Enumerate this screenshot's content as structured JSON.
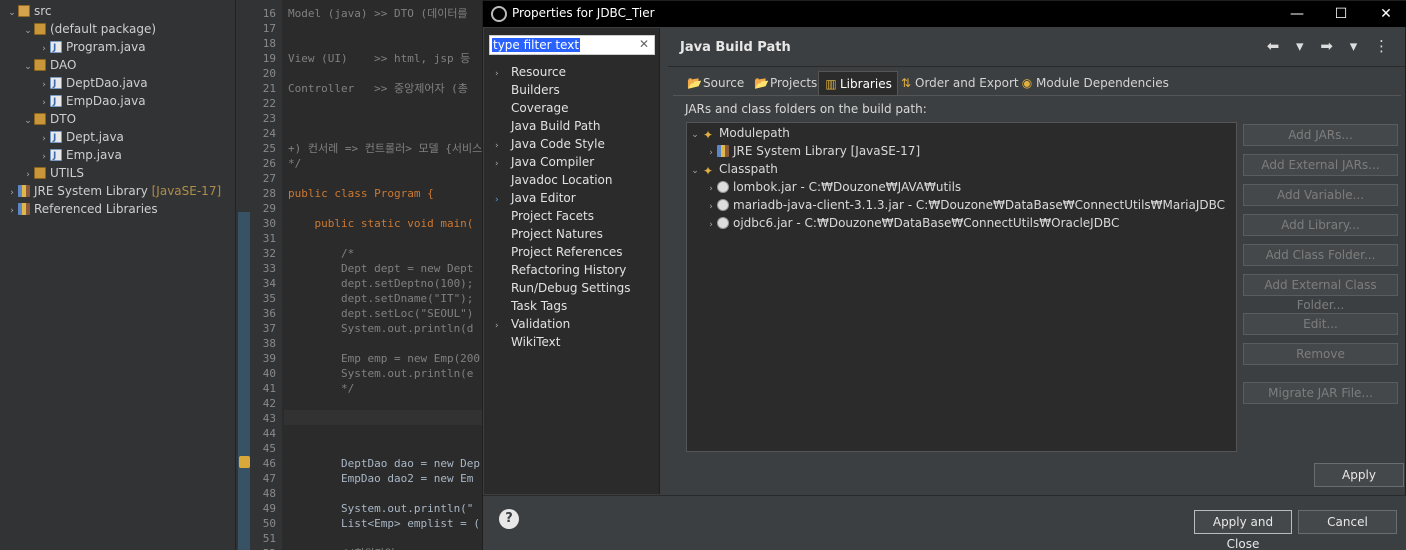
{
  "explorer": {
    "items": [
      {
        "label": "src",
        "icon": "folder-icon",
        "twisty": "⌄"
      },
      {
        "label": "(default package)",
        "icon": "package-icon",
        "twisty": "⌄"
      },
      {
        "label": "Program.java",
        "icon": "java-file-icon",
        "twisty": "›"
      },
      {
        "label": "DAO",
        "icon": "package-icon",
        "twisty": "⌄"
      },
      {
        "label": "DeptDao.java",
        "icon": "java-file-icon",
        "twisty": "›"
      },
      {
        "label": "EmpDao.java",
        "icon": "java-file-icon",
        "twisty": "›"
      },
      {
        "label": "DTO",
        "icon": "package-icon",
        "twisty": "⌄"
      },
      {
        "label": "Dept.java",
        "icon": "java-file-icon",
        "twisty": "›"
      },
      {
        "label": "Emp.java",
        "icon": "java-file-icon",
        "twisty": "›"
      },
      {
        "label": "UTILS",
        "icon": "package-icon",
        "twisty": "›"
      },
      {
        "label": "JRE System Library",
        "extra": "[JavaSE-17]",
        "icon": "library-icon",
        "twisty": "›"
      },
      {
        "label": "Referenced Libraries",
        "icon": "library-icon",
        "twisty": "›"
      }
    ]
  },
  "editor": {
    "lines": [
      {
        "n": "16",
        "text": "Model (java) >> DTO (데이터를",
        "kind": "cm"
      },
      {
        "n": "17",
        "text": "",
        "kind": "cm"
      },
      {
        "n": "18",
        "text": "",
        "kind": "cm"
      },
      {
        "n": "19",
        "text": "View (UI)    >> html, jsp 등",
        "kind": "cm"
      },
      {
        "n": "20",
        "text": "",
        "kind": "cm"
      },
      {
        "n": "21",
        "text": "Controller   >> 중앙제어자 (총",
        "kind": "cm"
      },
      {
        "n": "22",
        "text": "",
        "kind": "cm"
      },
      {
        "n": "23",
        "text": "",
        "kind": "cm"
      },
      {
        "n": "24",
        "text": "",
        "kind": "cm"
      },
      {
        "n": "25",
        "text": "+) 컨서레 => 컨트롤러> 모델 {서비스",
        "kind": "cm"
      },
      {
        "n": "26",
        "text": "*/",
        "kind": "cm"
      },
      {
        "n": "27",
        "text": "",
        "kind": "code"
      },
      {
        "n": "28",
        "text": "public class Program {",
        "kind": "kw"
      },
      {
        "n": "29",
        "text": "",
        "kind": "code"
      },
      {
        "n": "30",
        "text": "    public static void main(",
        "kind": "kw"
      },
      {
        "n": "31",
        "text": "",
        "kind": "code"
      },
      {
        "n": "32",
        "text": "        /*",
        "kind": "cm"
      },
      {
        "n": "33",
        "text": "        Dept dept = new Dept",
        "kind": "cm"
      },
      {
        "n": "34",
        "text": "        dept.setDeptno(100);",
        "kind": "cm"
      },
      {
        "n": "35",
        "text": "        dept.setDname(\"IT\");",
        "kind": "cm"
      },
      {
        "n": "36",
        "text": "        dept.setLoc(\"SEOUL\")",
        "kind": "cm"
      },
      {
        "n": "37",
        "text": "        System.out.println(d",
        "kind": "cm"
      },
      {
        "n": "38",
        "text": "",
        "kind": "cm"
      },
      {
        "n": "39",
        "text": "        Emp emp = new Emp(200",
        "kind": "cm"
      },
      {
        "n": "40",
        "text": "        System.out.println(e",
        "kind": "cm"
      },
      {
        "n": "41",
        "text": "        */",
        "kind": "cm"
      },
      {
        "n": "42",
        "text": "",
        "kind": "code"
      },
      {
        "n": "43",
        "text": "",
        "kind": "code"
      },
      {
        "n": "44",
        "text": "",
        "kind": "code"
      },
      {
        "n": "45",
        "text": "",
        "kind": "code"
      },
      {
        "n": "46",
        "text": "        DeptDao dao = new Dep",
        "kind": "code"
      },
      {
        "n": "47",
        "text": "        EmpDao dao2 = new Em",
        "kind": "code"
      },
      {
        "n": "48",
        "text": "",
        "kind": "code"
      },
      {
        "n": "49",
        "text": "        System.out.println(\"",
        "kind": "code"
      },
      {
        "n": "50",
        "text": "        List<Emp> emplist = (",
        "kind": "code"
      },
      {
        "n": "51",
        "text": "",
        "kind": "code"
      },
      {
        "n": "52",
        "text": "        //회원가입",
        "kind": "cm"
      }
    ]
  },
  "dialog": {
    "title": "Properties for JDBC_Tier",
    "window_buttons": {
      "minimize": "—",
      "maximize": "☐",
      "close": "✕"
    },
    "filter": {
      "value": "type filter text",
      "clear": "✕"
    },
    "nav": [
      {
        "label": "Resource",
        "twisty": "›"
      },
      {
        "label": "Builders",
        "twisty": ""
      },
      {
        "label": "Coverage",
        "twisty": ""
      },
      {
        "label": "Java Build Path",
        "twisty": ""
      },
      {
        "label": "Java Code Style",
        "twisty": "›"
      },
      {
        "label": "Java Compiler",
        "twisty": "›"
      },
      {
        "label": "Javadoc Location",
        "twisty": ""
      },
      {
        "label": "Java Editor",
        "twisty": "›"
      },
      {
        "label": "Project Facets",
        "twisty": ""
      },
      {
        "label": "Project Natures",
        "twisty": ""
      },
      {
        "label": "Project References",
        "twisty": ""
      },
      {
        "label": "Refactoring History",
        "twisty": ""
      },
      {
        "label": "Run/Debug Settings",
        "twisty": ""
      },
      {
        "label": "Task Tags",
        "twisty": ""
      },
      {
        "label": "Validation",
        "twisty": "›"
      },
      {
        "label": "WikiText",
        "twisty": ""
      }
    ],
    "page_title": "Java Build Path",
    "nav_arrows": "⬅ ▾ ➡ ▾ ⋮",
    "tabs": [
      {
        "label": "Source",
        "icon": "source-folder-icon",
        "glyph": "📂"
      },
      {
        "label": "Projects",
        "icon": "projects-icon",
        "glyph": "📂"
      },
      {
        "label": "Libraries",
        "icon": "libraries-icon",
        "glyph": "▥",
        "active": true
      },
      {
        "label": "Order and Export",
        "icon": "order-export-icon",
        "glyph": "⇅"
      },
      {
        "label": "Module Dependencies",
        "icon": "module-dependencies-icon",
        "glyph": "◉"
      }
    ],
    "jar_label": "JARs and class folders on the build path:",
    "tree": [
      {
        "label": "Modulepath",
        "twisty": "⌄",
        "icon": "modulepath-icon"
      },
      {
        "label": "JRE System Library [JavaSE-17]",
        "twisty": "›",
        "icon": "library-icon"
      },
      {
        "label": "Classpath",
        "twisty": "⌄",
        "icon": "classpath-icon"
      },
      {
        "label": "lombok.jar - C:₩Douzone₩JAVA₩utils",
        "twisty": "›",
        "icon": "jar-icon"
      },
      {
        "label": "mariadb-java-client-3.1.3.jar - C:₩Douzone₩DataBase₩ConnectUtils₩MariaJDBC",
        "twisty": "›",
        "icon": "jar-icon"
      },
      {
        "label": "ojdbc6.jar - C:₩Douzone₩DataBase₩ConnectUtils₩OracleJDBC",
        "twisty": "›",
        "icon": "jar-icon"
      }
    ],
    "side_buttons": [
      "Add JARs...",
      "Add External JARs...",
      "Add Variable...",
      "Add Library...",
      "Add Class Folder...",
      "Add External Class Folder...",
      "Edit...",
      "Remove",
      "Migrate JAR File..."
    ],
    "apply": "Apply",
    "help": "?",
    "apply_close": "Apply and Close",
    "cancel": "Cancel"
  }
}
